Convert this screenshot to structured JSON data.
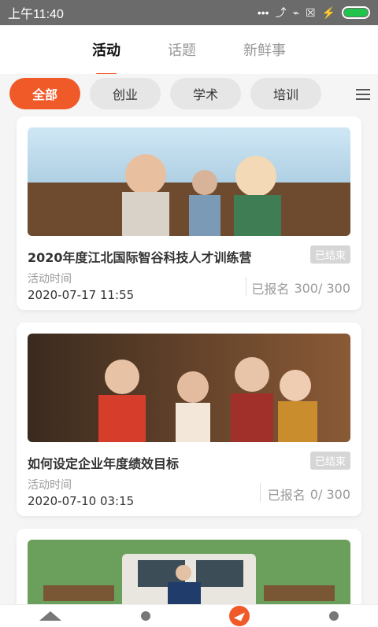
{
  "status": {
    "time": "上午11:40",
    "icons": [
      "more-icon",
      "no-sound-icon",
      "wifi-icon",
      "sim-icon",
      "charging-icon",
      "battery-icon"
    ],
    "battery_color": "#22c34b"
  },
  "top_tabs": [
    {
      "label": "活动",
      "active": true
    },
    {
      "label": "话题",
      "active": false
    },
    {
      "label": "新鲜事",
      "active": false
    }
  ],
  "filters": [
    {
      "label": "全部",
      "active": true
    },
    {
      "label": "创业",
      "active": false
    },
    {
      "label": "学术",
      "active": false
    },
    {
      "label": "培训",
      "active": false
    }
  ],
  "cards": [
    {
      "title": "2020年度江北国际智谷科技人才训练营",
      "status": "已结束",
      "time_label": "活动时间",
      "time": "2020-07-17 11:55",
      "signup_label": "已报名",
      "signup_count": "300/ 300"
    },
    {
      "title": "如何设定企业年度绩效目标",
      "status": "已结束",
      "time_label": "活动时间",
      "time": "2020-07-10 03:15",
      "signup_label": "已报名",
      "signup_count": "0/ 300"
    }
  ],
  "colors": {
    "accent": "#f05a28"
  }
}
